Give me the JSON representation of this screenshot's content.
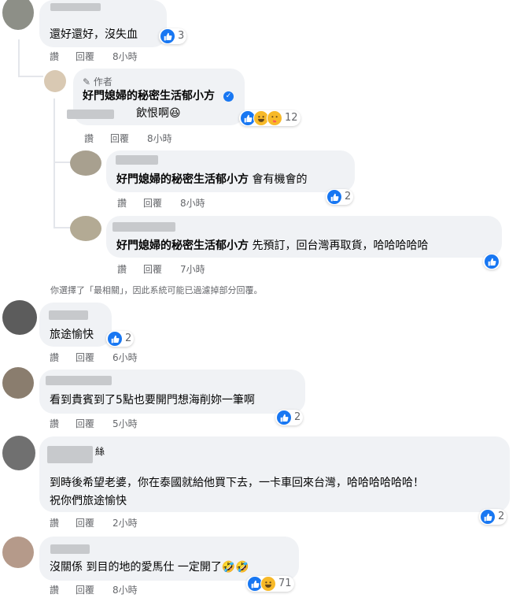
{
  "comments": [
    {
      "text": "還好還好，沒失血",
      "reactions": {
        "icons": [
          "like"
        ],
        "count": "3"
      },
      "actions": {
        "reply_a": "讚",
        "reply_b": "回覆",
        "time": "8小時"
      }
    },
    {
      "author_badge": "作者",
      "author": "好門媳婦的秘密生活郁小方",
      "text": "飲恨啊😆",
      "reactions": {
        "icons": [
          "like",
          "haha",
          "care"
        ],
        "count": "12"
      },
      "actions": {
        "reply_a": "讚",
        "reply_b": "回覆",
        "time": "8小時"
      }
    },
    {
      "mention": "好門媳婦的秘密生活郁小方",
      "text": " 會有機會的",
      "reactions": {
        "icons": [
          "like"
        ],
        "count": "2"
      },
      "actions": {
        "reply_a": "讚",
        "reply_b": "回覆",
        "time": "8小時"
      }
    },
    {
      "mention": "好門媳婦的秘密生活郁小方",
      "text": " 先預訂，回台灣再取貨，哈哈哈哈哈",
      "reactions": {
        "icons": [
          "like"
        ],
        "count": ""
      },
      "actions": {
        "reply_a": "讚",
        "reply_b": "回覆",
        "time": "7小時"
      }
    },
    {
      "text": "旅途愉快",
      "reactions": {
        "icons": [
          "like"
        ],
        "count": "2"
      },
      "actions": {
        "reply_a": "讚",
        "reply_b": "回覆",
        "time": "6小時"
      }
    },
    {
      "text": "看到貴賓到了5點也要開門想海削妳一筆啊",
      "reactions": {
        "icons": [
          "like"
        ],
        "count": "2"
      },
      "actions": {
        "reply_a": "讚",
        "reply_b": "回覆",
        "time": "5小時"
      }
    },
    {
      "name_suffix": "絲",
      "text_line1": "到時後希望老婆，你在泰國就給他買下去，一卡車回來台灣，哈哈哈哈哈哈！",
      "text_line2": "祝你們旅途愉快",
      "reactions": {
        "icons": [
          "like"
        ],
        "count": "2"
      },
      "actions": {
        "reply_a": "讚",
        "reply_b": "回覆",
        "time": "2小時"
      }
    },
    {
      "text": "沒關係 到目的地的愛馬仕 一定開了🤣🤣",
      "reactions": {
        "icons": [
          "like",
          "haha"
        ],
        "count": "71"
      },
      "actions": {
        "reply_a": "讚",
        "reply_b": "回覆",
        "time": "8小時"
      }
    }
  ],
  "filter_notice": "你選擇了「最相關」，因此系統可能已過濾掉部分回覆。",
  "colors": {
    "like": "#1877f2",
    "bubble": "#f0f2f5",
    "meta": "#65676b"
  }
}
